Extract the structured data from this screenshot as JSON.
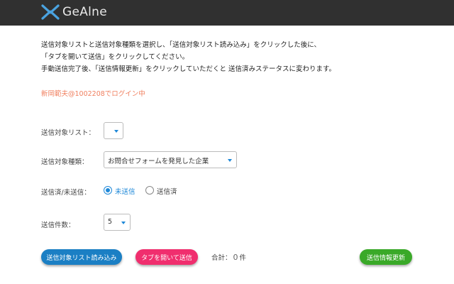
{
  "header": {
    "brand": "GeAlne"
  },
  "instructions": [
    "送信対象リストと送信対象種類を選択し、「送信対象リスト読み込み」をクリックした後に、",
    "「タブを開いて送信」をクリックしてください。",
    "手動送信完了後、「送信情報更新」をクリックしていただくと 送信済みステータスに変わります。"
  ],
  "login_status": "新岡範夫@1002208でログイン中",
  "form": {
    "list_label": "送信対象リスト：",
    "list_value": "",
    "type_label": "送信対象種類：",
    "type_value": "お問合せフォームを発見した企業",
    "status_label": "送信済/未送信：",
    "status_options": [
      "未送信",
      "送信済"
    ],
    "status_selected": "未送信",
    "count_label": "送信件数：",
    "count_value": "5"
  },
  "actions": {
    "load_label": "送信対象リスト読み込み",
    "open_tabs_label": "タブを開いて送信",
    "total_prefix": "合計：",
    "total_count": "0",
    "total_unit": "件",
    "update_label": "送信情報更新"
  },
  "colors": {
    "header_bg": "#303030",
    "accent": "#1e88d8",
    "login_text": "#f08060",
    "load_button": "#1b7fc4",
    "open_tabs_button": "#f02e6e",
    "update_button": "#3aa928"
  }
}
